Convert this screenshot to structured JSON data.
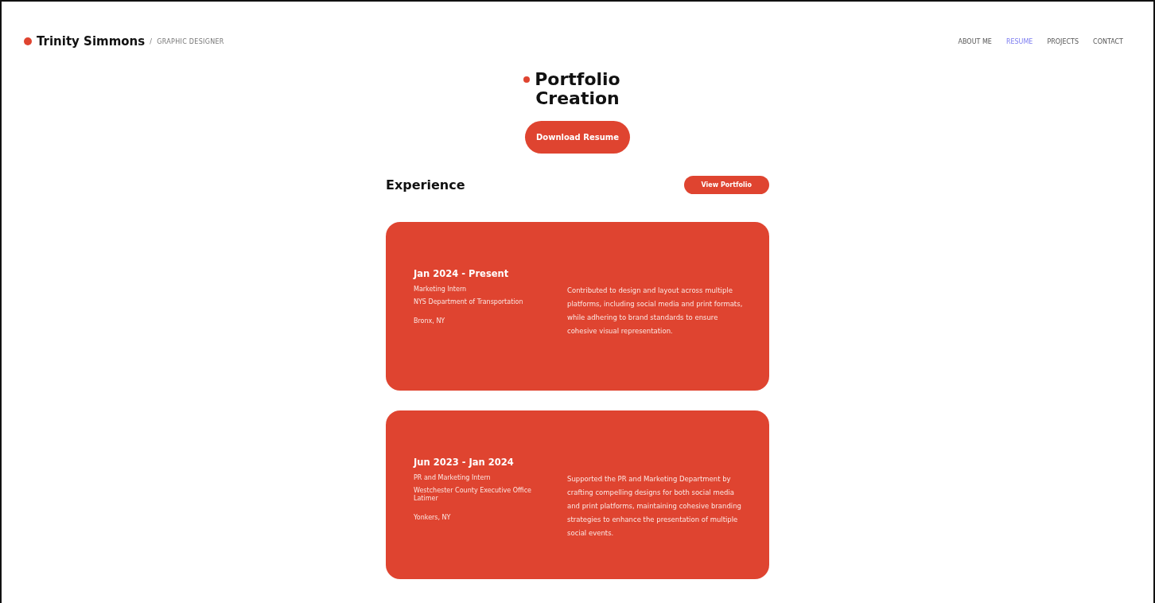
{
  "header": {
    "name": "Trinity Simmons",
    "separator": "/",
    "role": "GRAPHIC DESIGNER"
  },
  "nav": [
    {
      "label": "ABOUT ME",
      "selected": false
    },
    {
      "label": "RESUME",
      "selected": true
    },
    {
      "label": "PROJECTS",
      "selected": false
    },
    {
      "label": "CONTACT",
      "selected": false
    }
  ],
  "hero": {
    "title_lines": [
      "Portfolio",
      "Creation"
    ],
    "button": "Download Resume"
  },
  "experience": {
    "title": "Experience",
    "button": "View Portfolio",
    "jobs": [
      {
        "dates": "Jan 2024 - Present",
        "role": "Marketing Intern",
        "org": "NYS Department of Transportation",
        "location": "Bronx, NY",
        "description": "Contributed to design and layout across multiple platforms, including social media and print formats, while adhering to brand standards to ensure cohesive visual representation."
      },
      {
        "dates": "Jun 2023 - Jan 2024",
        "role": "PR and Marketing Intern",
        "org": "Westchester County Executive Office Latimer",
        "location": "Yonkers, NY",
        "description": "Supported the PR and Marketing Department by crafting compelling designs for both social media and print platforms, maintaining cohesive branding strategies to enhance the presentation of multiple social events."
      }
    ]
  }
}
